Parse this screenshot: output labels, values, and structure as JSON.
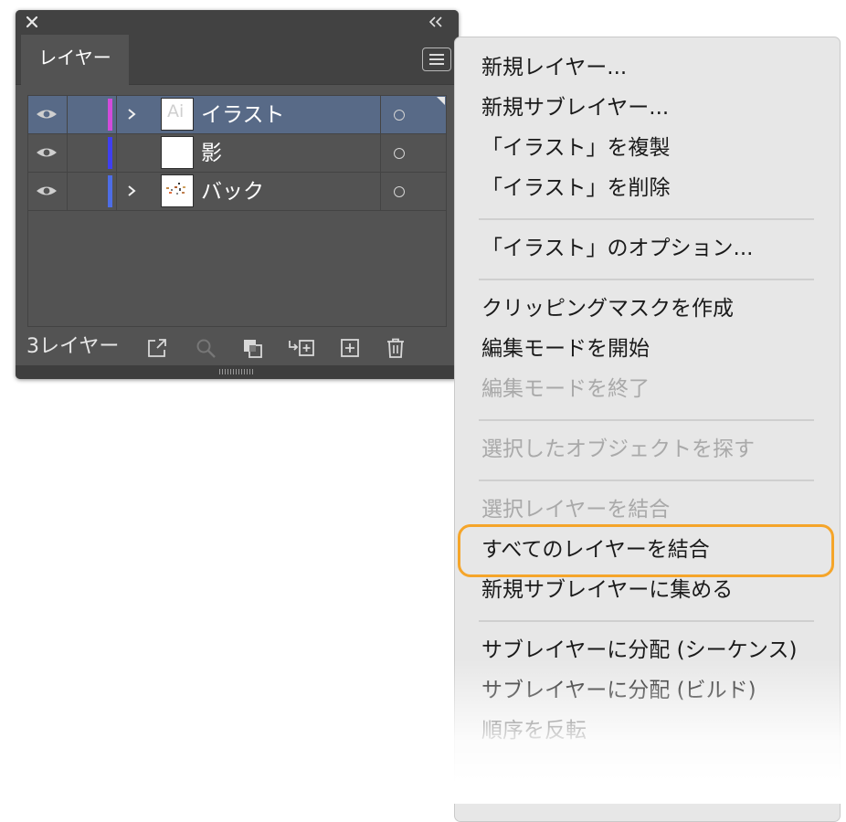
{
  "layers_panel": {
    "tab_label": "レイヤー",
    "layers": [
      {
        "name": "イラスト",
        "color": "#d24bdb",
        "selected": true,
        "has_children": true,
        "thumb_text": "Ai"
      },
      {
        "name": "影",
        "color": "#3f3ff0",
        "selected": false,
        "has_children": false
      },
      {
        "name": "バック",
        "color": "#4d6de6",
        "selected": false,
        "has_children": true
      }
    ],
    "layer_count": "3レイヤー"
  },
  "flyout_menu": {
    "items": [
      {
        "label": "新規レイヤー...",
        "enabled": true
      },
      {
        "label": "新規サブレイヤー...",
        "enabled": true
      },
      {
        "label": "「イラスト」を複製",
        "enabled": true
      },
      {
        "label": "「イラスト」を削除",
        "enabled": true
      },
      {
        "label": "「イラスト」のオプション...",
        "enabled": true
      },
      {
        "label": "クリッピングマスクを作成",
        "enabled": true
      },
      {
        "label": "編集モードを開始",
        "enabled": true
      },
      {
        "label": "編集モードを終了",
        "enabled": false
      },
      {
        "label": "選択したオブジェクトを探す",
        "enabled": false
      },
      {
        "label": "選択レイヤーを結合",
        "enabled": false
      },
      {
        "label": "すべてのレイヤーを結合",
        "enabled": true,
        "highlighted": true
      },
      {
        "label": "新規サブレイヤーに集める",
        "enabled": true
      },
      {
        "label": "サブレイヤーに分配 (シーケンス)",
        "enabled": true
      },
      {
        "label": "サブレイヤーに分配 (ビルド)",
        "enabled": true
      },
      {
        "label": "順序を反転",
        "enabled": true
      }
    ],
    "highlight_color": "#f5a52a"
  }
}
